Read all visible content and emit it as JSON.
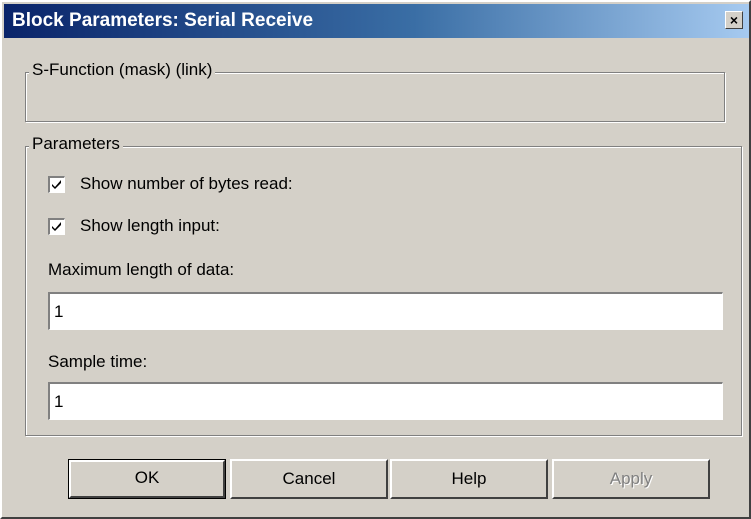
{
  "window": {
    "title": "Block Parameters: Serial Receive",
    "close_glyph": "×"
  },
  "mask_group": {
    "label": "S-Function (mask) (link)"
  },
  "params_group": {
    "label": "Parameters",
    "checkboxes": [
      {
        "label": "Show number of bytes read:",
        "checked": true
      },
      {
        "label": "Show length input:",
        "checked": true
      }
    ],
    "fields": [
      {
        "label": "Maximum length of data:",
        "value": "1"
      },
      {
        "label": "Sample time:",
        "value": "1"
      }
    ]
  },
  "buttons": {
    "ok": "OK",
    "cancel": "Cancel",
    "help": "Help",
    "apply": "Apply"
  },
  "colors": {
    "title_gradient_start": "#0a246a",
    "title_gradient_end": "#a6caf0",
    "dialog_background": "#d4d0c8"
  }
}
